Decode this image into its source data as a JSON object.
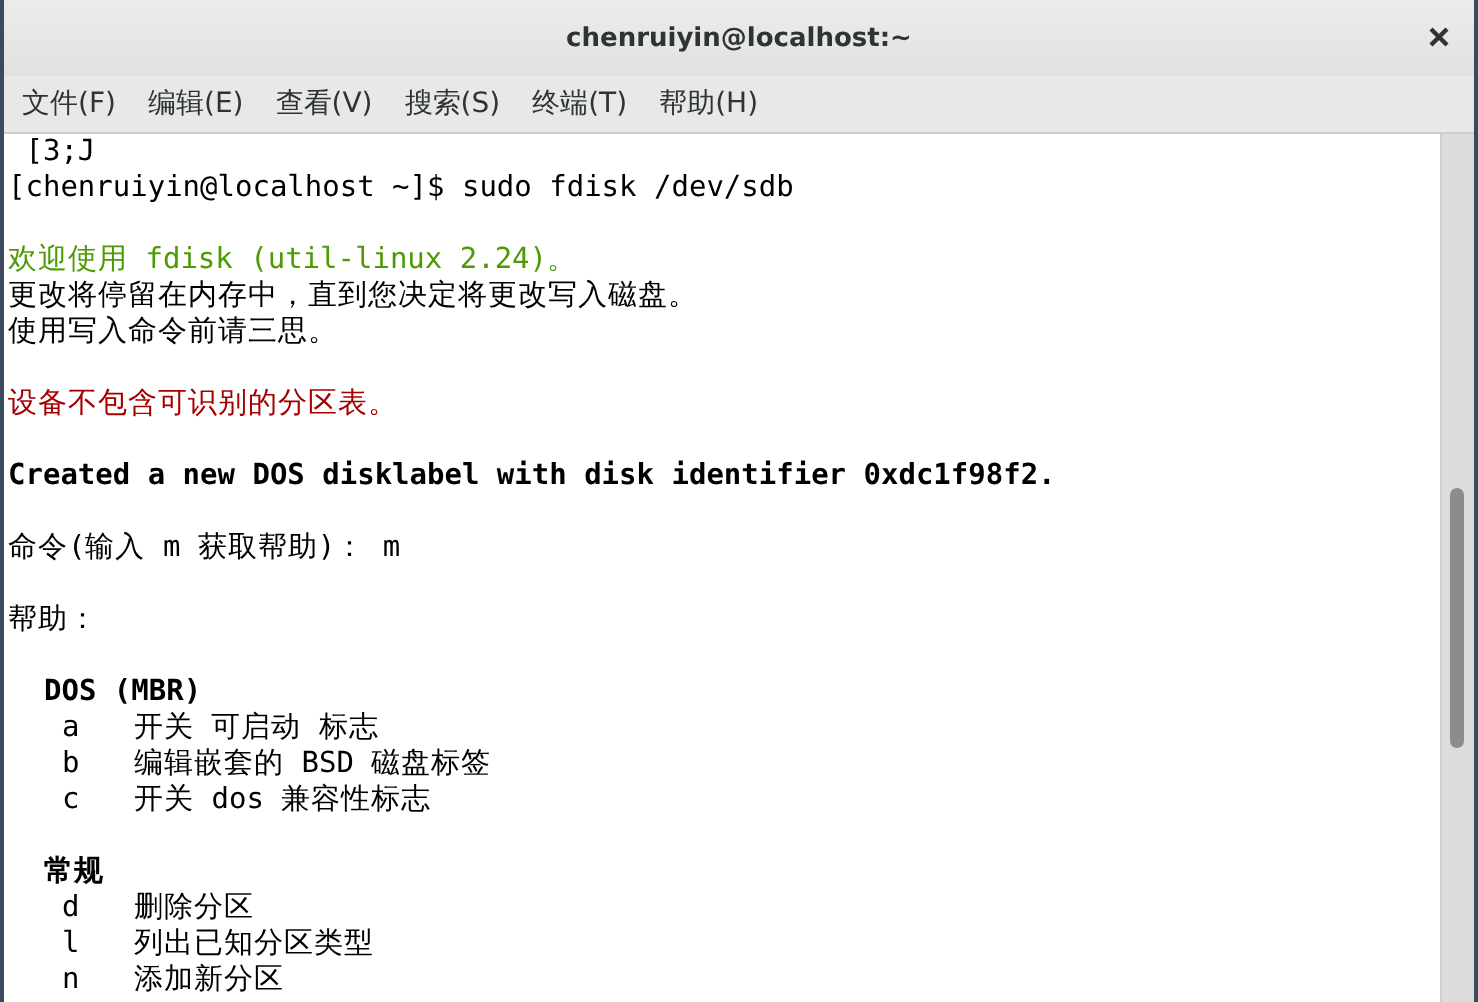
{
  "window": {
    "title": "chenruiyin@localhost:~"
  },
  "menu": [
    "文件(F)",
    "编辑(E)",
    "查看(V)",
    "搜索(S)",
    "终端(T)",
    "帮助(H)"
  ],
  "terminal": {
    "lines": [
      {
        "kind": "text",
        "text": " [3;J"
      },
      {
        "kind": "text",
        "text": "[chenruiyin@localhost ~]$ sudo fdisk /dev/sdb"
      },
      {
        "kind": "blank"
      },
      {
        "kind": "green",
        "text": "欢迎使用 fdisk (util-linux 2.24)。"
      },
      {
        "kind": "text",
        "text": "更改将停留在内存中，直到您决定将更改写入磁盘。"
      },
      {
        "kind": "text",
        "text": "使用写入命令前请三思。"
      },
      {
        "kind": "blank"
      },
      {
        "kind": "red",
        "text": "设备不包含可识别的分区表。"
      },
      {
        "kind": "blank"
      },
      {
        "kind": "bold",
        "text": "Created a new DOS disklabel with disk identifier 0xdc1f98f2."
      },
      {
        "kind": "blank"
      },
      {
        "kind": "text",
        "text": "命令(输入 m 获取帮助)： m"
      },
      {
        "kind": "blank"
      },
      {
        "kind": "text",
        "text": "帮助："
      },
      {
        "kind": "blank"
      },
      {
        "kind": "heading",
        "text": "DOS (MBR)"
      },
      {
        "kind": "entry",
        "key": "a",
        "text": "开关 可启动 标志"
      },
      {
        "kind": "entry",
        "key": "b",
        "text": "编辑嵌套的 BSD 磁盘标签"
      },
      {
        "kind": "entry",
        "key": "c",
        "text": "开关 dos 兼容性标志"
      },
      {
        "kind": "blank"
      },
      {
        "kind": "heading",
        "text": "常规"
      },
      {
        "kind": "entry",
        "key": "d",
        "text": "删除分区"
      },
      {
        "kind": "entry",
        "key": "l",
        "text": "列出已知分区类型"
      },
      {
        "kind": "entry",
        "key": "n",
        "text": "添加新分区"
      }
    ]
  }
}
